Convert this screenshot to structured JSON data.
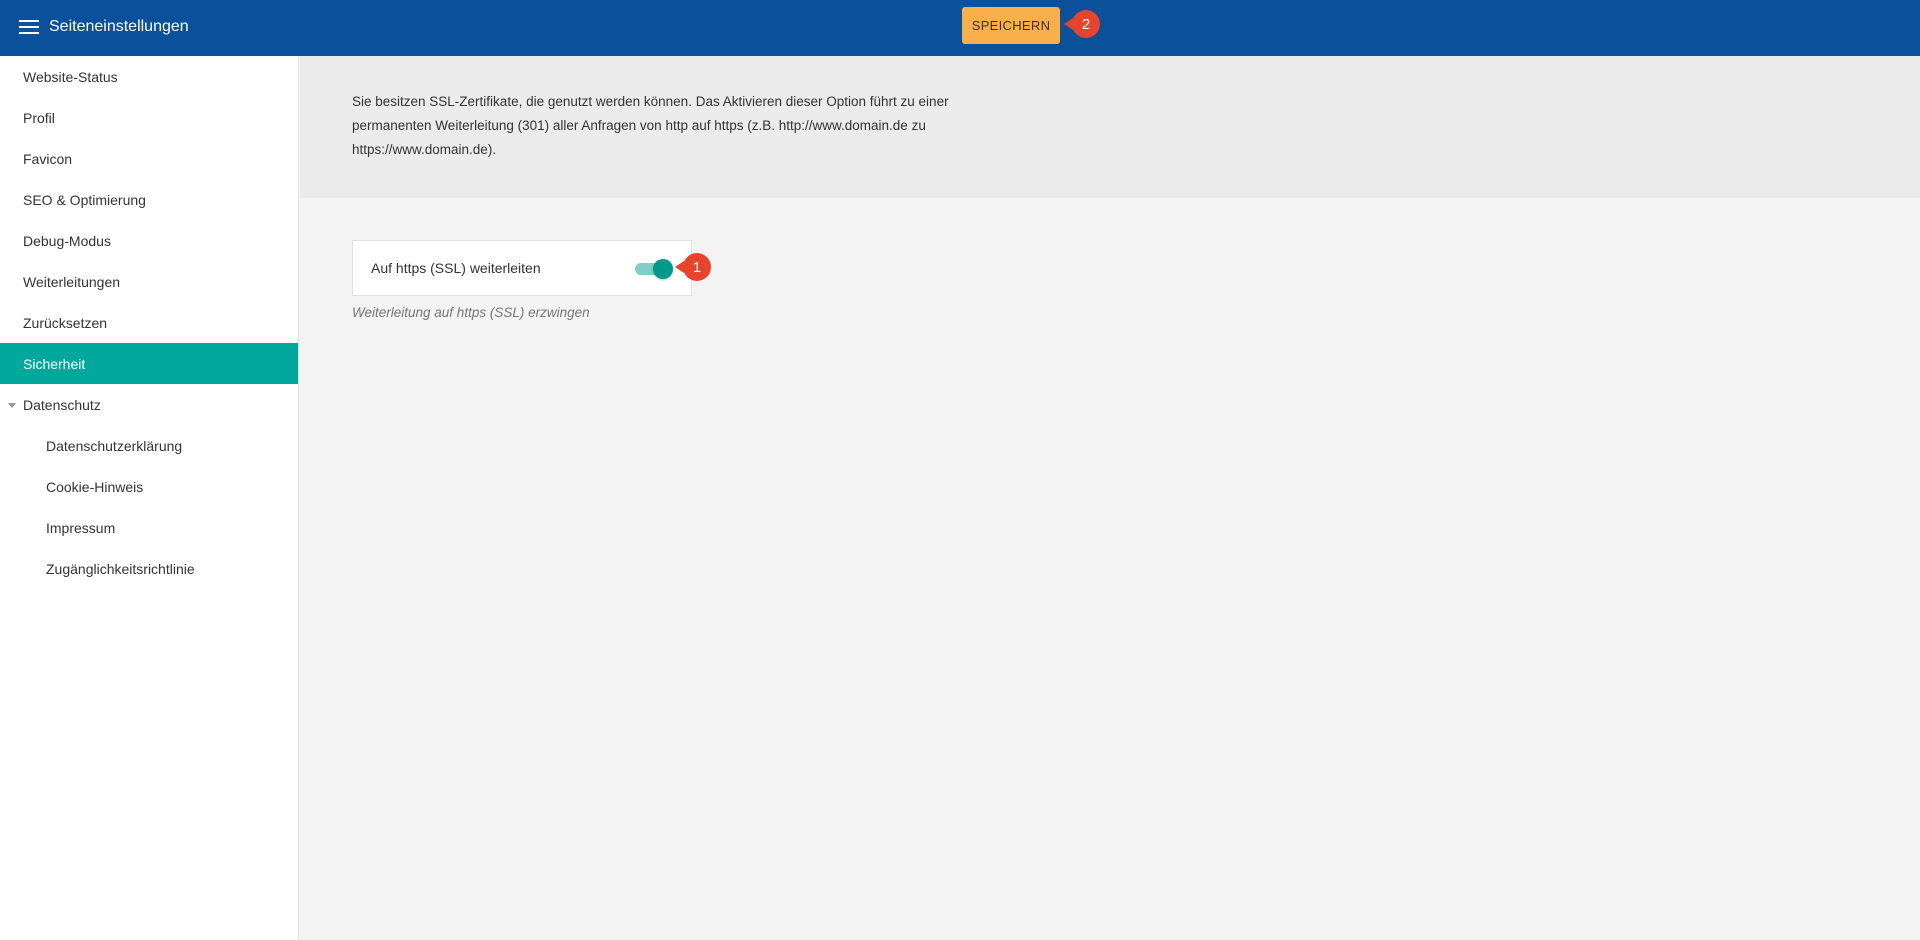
{
  "app": {
    "title": "Seiteneinstellungen",
    "save_label": "SPEICHERN",
    "save_callout": "2"
  },
  "sidebar": {
    "items": [
      {
        "label": "Website-Status"
      },
      {
        "label": "Profil"
      },
      {
        "label": "Favicon"
      },
      {
        "label": "SEO & Optimierung"
      },
      {
        "label": "Debug-Modus"
      },
      {
        "label": "Weiterleitungen"
      },
      {
        "label": "Zurücksetzen"
      },
      {
        "label": "Sicherheit",
        "active": true
      },
      {
        "label": "Datenschutz",
        "expanded": true
      },
      {
        "label": "Datenschutzerklärung"
      },
      {
        "label": "Cookie-Hinweis"
      },
      {
        "label": "Impressum"
      },
      {
        "label": "Zugänglichkeitsrichtlinie"
      }
    ]
  },
  "main": {
    "info_text": "Sie besitzen SSL-Zertifikate, die genutzt werden können. Das Aktivieren dieser Option führt zu einer permanenten Weiterleitung (301) aller Anfragen von http auf https (z.B. http://www.domain.de zu https://www.domain.de).",
    "setting": {
      "label": "Auf https (SSL) weiterleiten",
      "enabled": true,
      "callout": "1",
      "hint": "Weiterleitung auf https (SSL) erzwingen"
    }
  },
  "colors": {
    "topbar": "#0a509a",
    "accent": "#00a89b",
    "save_button": "#f9b04b",
    "callout": "#e8432b"
  },
  "icons": {
    "menu": "hamburger-menu-icon",
    "caret": "caret-down-icon"
  }
}
